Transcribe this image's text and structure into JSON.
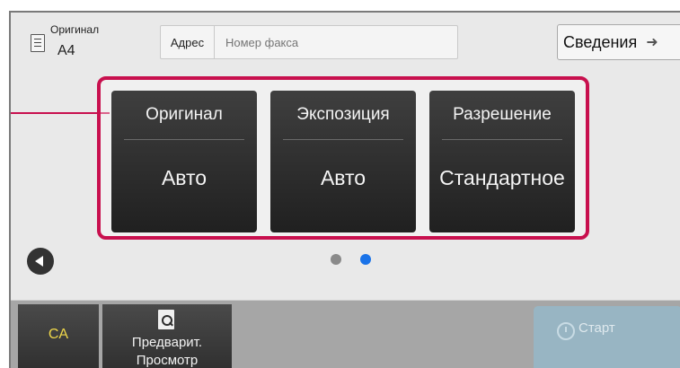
{
  "original_info": {
    "label": "Оригинал",
    "size": "A4"
  },
  "address": {
    "label": "Адрес",
    "placeholder": "Номер факса"
  },
  "details_button": {
    "label": "Сведения",
    "arrow": "➜"
  },
  "settings": [
    {
      "title": "Оригинал",
      "value": "Авто"
    },
    {
      "title": "Экспозиция",
      "value": "Авто"
    },
    {
      "title": "Разрешение",
      "value": "Стандартное"
    }
  ],
  "pager": {
    "page_count": 2,
    "current_page": 2
  },
  "bottom_bar": {
    "ca_label": "CA",
    "preview_line1": "Предварит.",
    "preview_line2": "Просмотр",
    "start_label": "Старт"
  },
  "colors": {
    "highlight": "#c8104e",
    "ca_text": "#f0d84a",
    "dot_active": "#1a73e8",
    "dot_inactive": "#8a8a8a",
    "start_button": "#98b5c3"
  },
  "icons": {
    "original": "document-icon",
    "details": "arrow-right-icon",
    "prev": "chevron-left-icon",
    "preview": "magnifier-document-icon",
    "start": "start-icon"
  }
}
